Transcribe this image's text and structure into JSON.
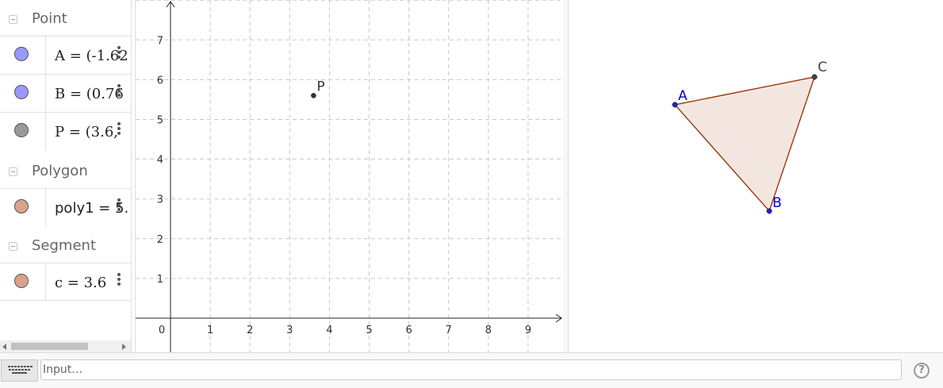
{
  "algebra": {
    "groups": [
      {
        "label": "Point",
        "items": [
          {
            "text": "A = (-1.62",
            "color": "#9999ff"
          },
          {
            "text": "B = (0.76",
            "color": "#9999ff"
          },
          {
            "text": "P = (3.6,",
            "color": "#999999"
          }
        ]
      },
      {
        "label": "Polygon",
        "items": [
          {
            "text": "poly1 = 5.",
            "color": "#d9a28c"
          }
        ]
      },
      {
        "label": "Segment",
        "items": [
          {
            "text": "c = 3.6",
            "color": "#d9a28c"
          }
        ]
      }
    ]
  },
  "graphics1": {
    "x_ticks": [
      "0",
      "1",
      "2",
      "3",
      "4",
      "5",
      "6",
      "7",
      "8",
      "9"
    ],
    "y_ticks": [
      "1",
      "2",
      "3",
      "4",
      "5",
      "6",
      "7"
    ],
    "point_P": {
      "label": "P",
      "x": 3.6,
      "y": 5.6,
      "color": "#333333"
    }
  },
  "graphics2": {
    "labels": {
      "A": "A",
      "B": "B",
      "C": "C"
    },
    "label_colors": {
      "A": "#0000cc",
      "B": "#0000cc",
      "C": "#444444"
    },
    "polygon_fill": "#f3e6e0",
    "polygon_stroke": "#993300"
  },
  "inputbar": {
    "placeholder": "Input…",
    "help_glyph": "?"
  }
}
